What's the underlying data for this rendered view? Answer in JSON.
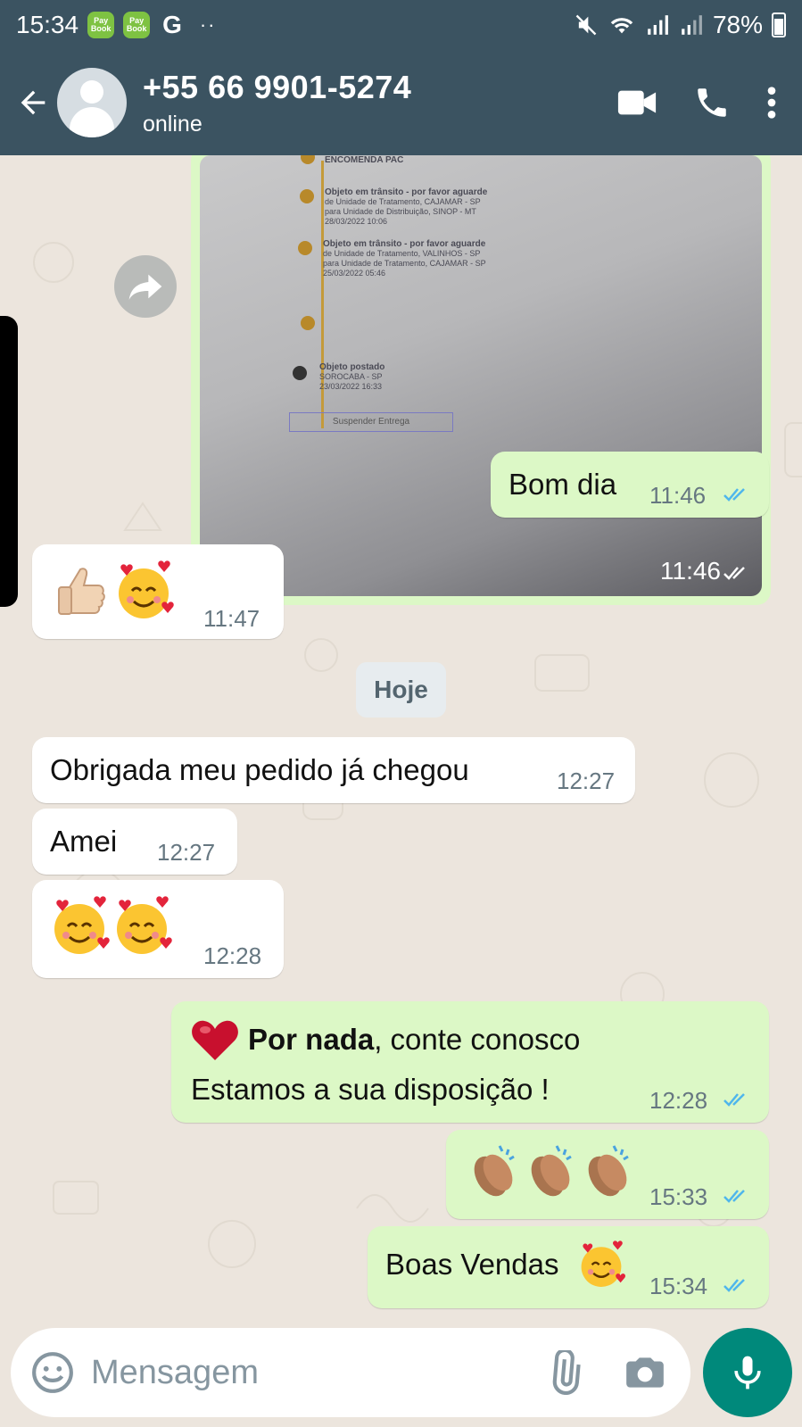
{
  "status_bar": {
    "time": "15:34",
    "battery": "78%",
    "app_badge": "Pay Book",
    "g_icon": "G",
    "dots": "··"
  },
  "header": {
    "contact_name": "+55 66 9901-5274",
    "contact_status": "online"
  },
  "photo_message": {
    "time": "11:46",
    "lines": [
      "ENCOMENDA PAC",
      "Objeto em trânsito - por favor aguarde",
      "de Unidade de Tratamento, CAJAMAR - SP",
      "para Unidade de Distribuição, SINOP - MT",
      "28/03/2022 10:06",
      "Objeto em trânsito - por favor aguarde",
      "de Unidade de Tratamento, VALINHOS - SP",
      "para Unidade de Tratamento, CAJAMAR - SP",
      "25/03/2022 05:46",
      "Objeto postado",
      "SOROCABA - SP",
      "23/03/2022 16:33",
      "Suspender Entrega"
    ]
  },
  "messages": [
    {
      "text": "Bom dia",
      "time": "11:46"
    },
    {
      "text": "",
      "time": "11:47"
    },
    {
      "text": "Obrigada meu pedido já chegou",
      "time": "12:27"
    },
    {
      "text": "Amei",
      "time": "12:27"
    },
    {
      "text": "",
      "time": "12:28"
    },
    {
      "bold": "Por nada",
      "text": ", conte conosco",
      "text2": "Estamos a sua disposição !",
      "time": "12:28"
    },
    {
      "text": "",
      "time": "15:33"
    },
    {
      "text": "Boas Vendas",
      "time": "15:34"
    }
  ],
  "day_divider": "Hoje",
  "composer": {
    "placeholder": "Mensagem"
  },
  "colors": {
    "header": "#3b5361",
    "outgoing": "#dcf8c6",
    "incoming": "#ffffff",
    "accent": "#00897b",
    "read_ticks": "#4fb6ec"
  },
  "icons": [
    "back-arrow-icon",
    "avatar-icon",
    "video-call-icon",
    "phone-icon",
    "more-vert-icon",
    "forward-icon",
    "emoji-icon",
    "attach-icon",
    "camera-icon",
    "mic-icon"
  ]
}
